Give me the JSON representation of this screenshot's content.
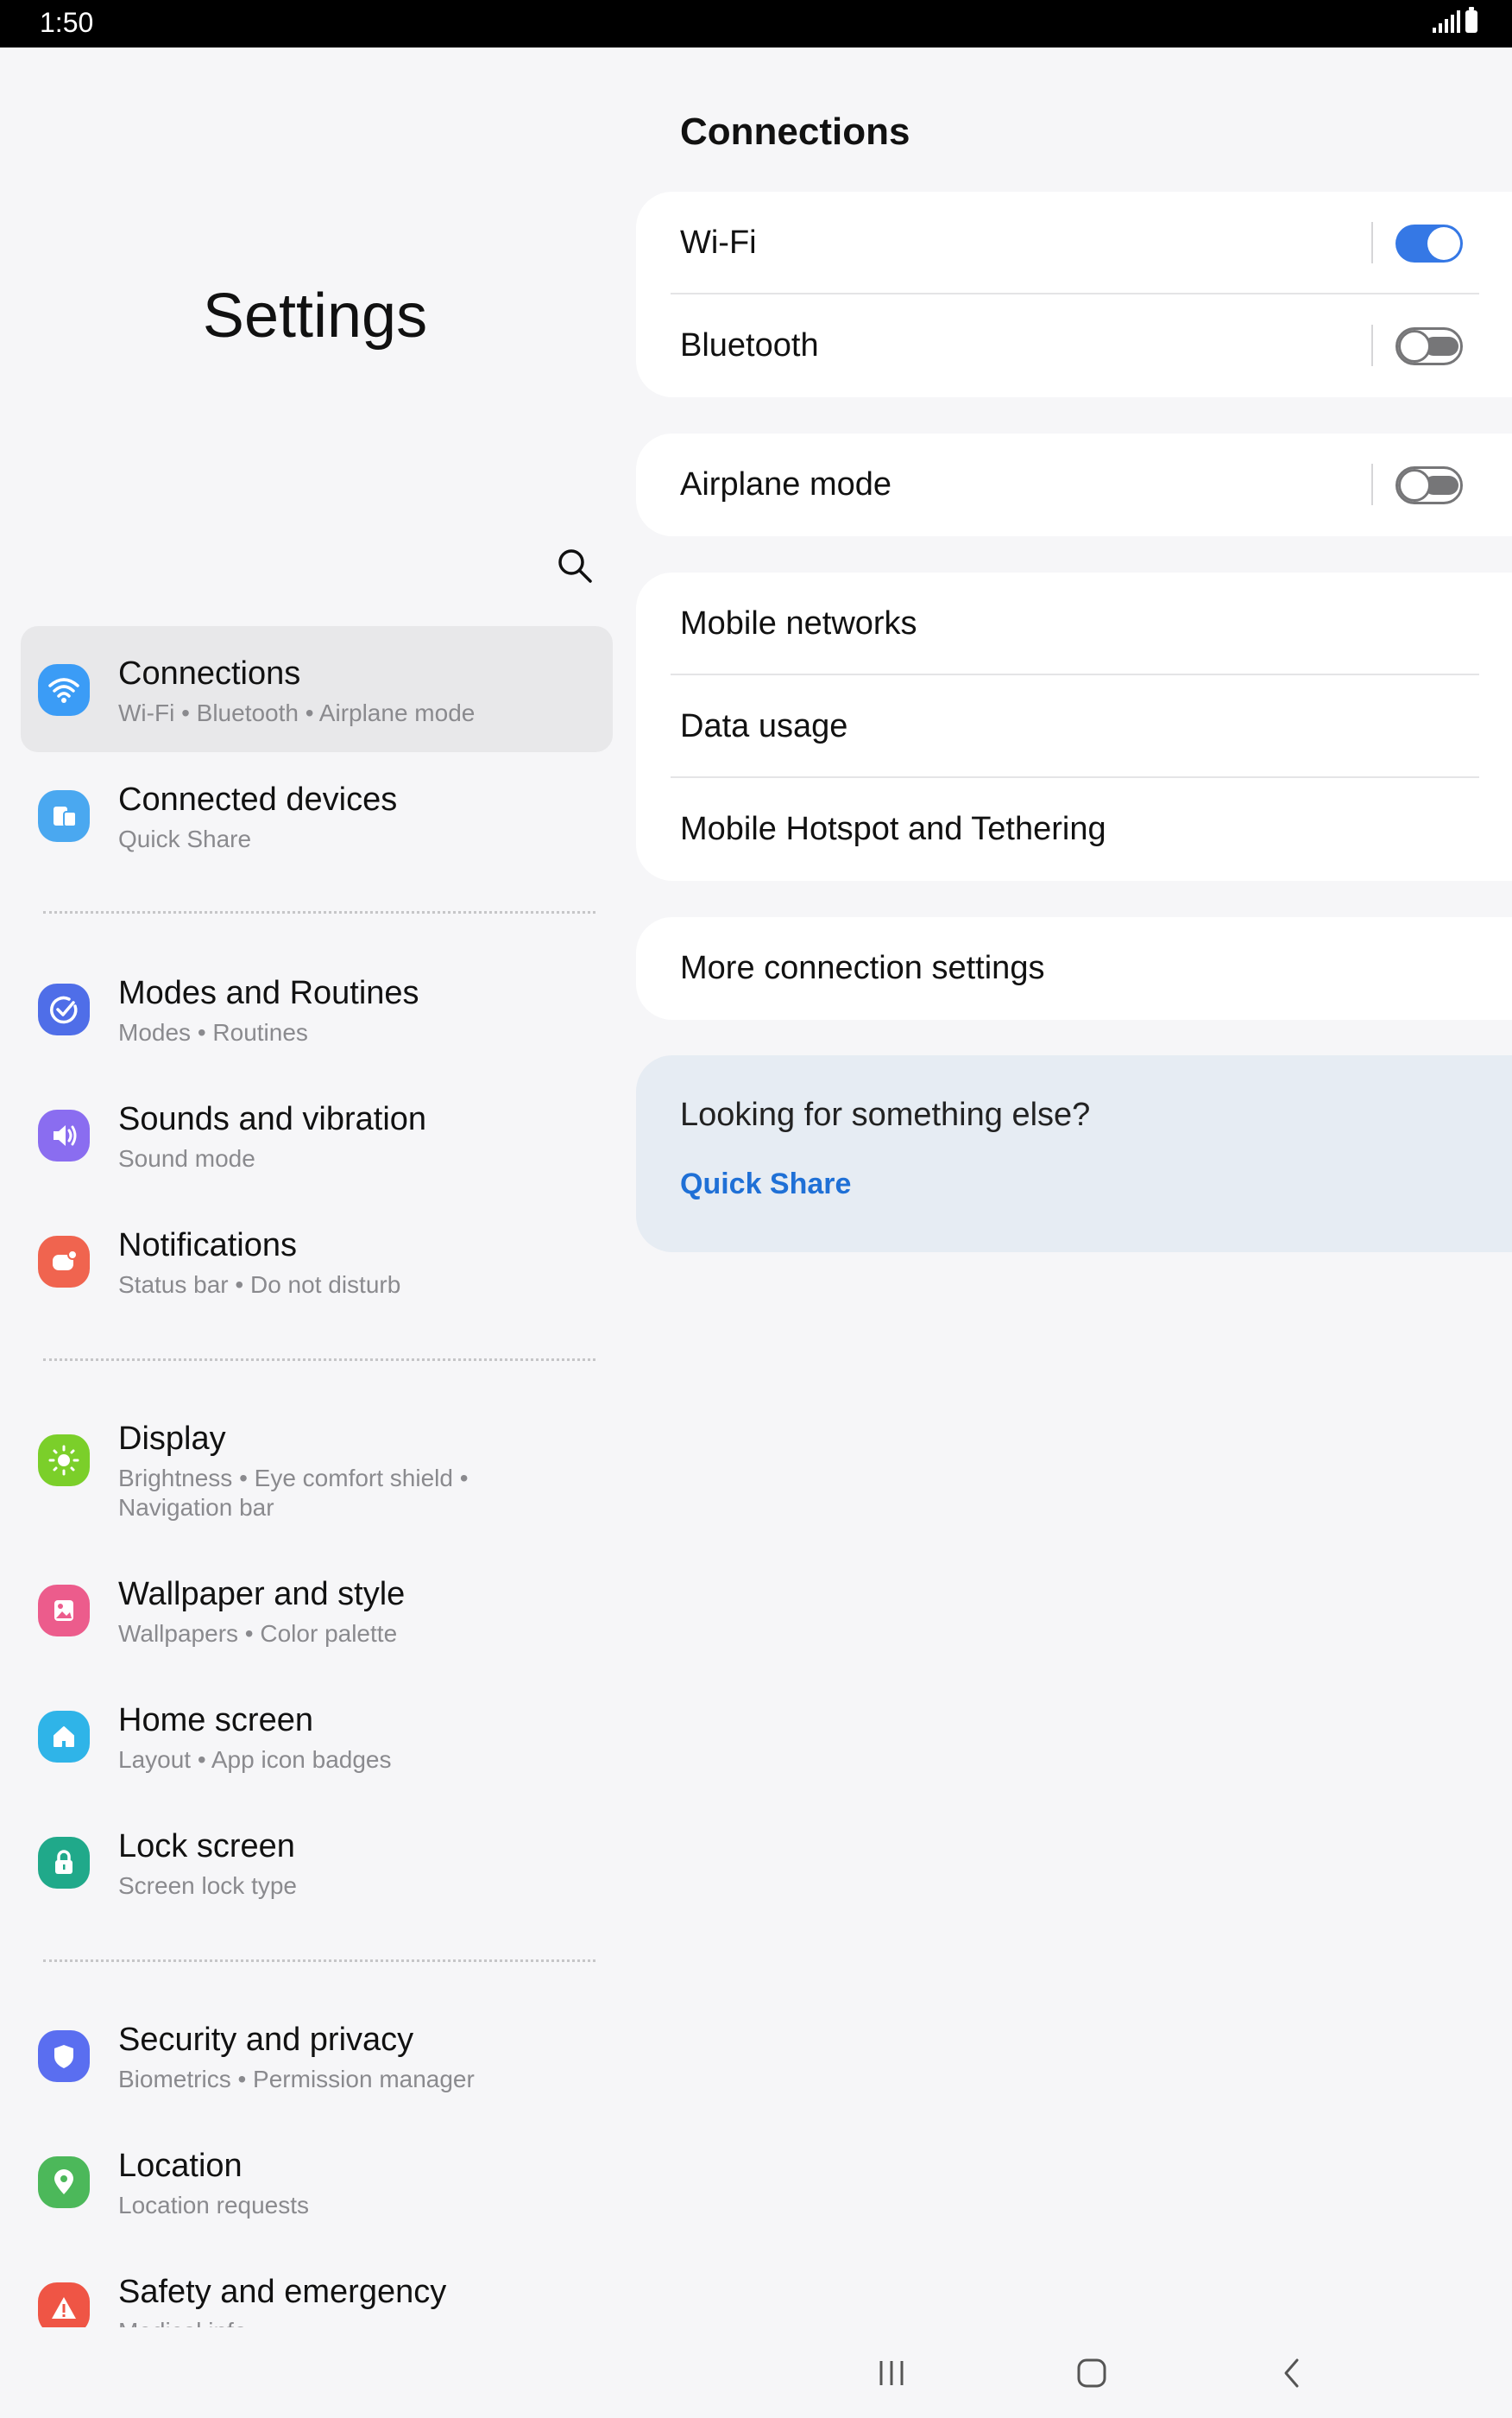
{
  "status_bar": {
    "time": "1:50"
  },
  "left": {
    "title": "Settings",
    "menu": [
      {
        "title": "Connections",
        "subtitle": "Wi-Fi  •  Bluetooth  •  Airplane mode",
        "icon": "wifi-icon",
        "color": "#3b9cf6",
        "active": true
      },
      {
        "title": "Connected devices",
        "subtitle": "Quick Share",
        "icon": "devices-icon",
        "color": "#4aa8f0"
      },
      {
        "title": "Modes and Routines",
        "subtitle": "Modes  •  Routines",
        "icon": "check-circle-icon",
        "color": "#4f6ee8"
      },
      {
        "title": "Sounds and vibration",
        "subtitle": "Sound mode",
        "icon": "speaker-icon",
        "color": "#8a6df0"
      },
      {
        "title": "Notifications",
        "subtitle": "Status bar  •  Do not disturb",
        "icon": "notification-icon",
        "color": "#f0644f"
      },
      {
        "title": "Display",
        "subtitle": "Brightness  •  Eye comfort shield  •\nNavigation bar",
        "icon": "sun-icon",
        "color": "#7bcf2a"
      },
      {
        "title": "Wallpaper and style",
        "subtitle": "Wallpapers  •  Color palette",
        "icon": "wallpaper-icon",
        "color": "#ec5c8c"
      },
      {
        "title": "Home screen",
        "subtitle": "Layout  •  App icon badges",
        "icon": "home-icon",
        "color": "#2fb4e8"
      },
      {
        "title": "Lock screen",
        "subtitle": "Screen lock type",
        "icon": "lock-icon",
        "color": "#20a98a"
      },
      {
        "title": "Security and privacy",
        "subtitle": "Biometrics  •  Permission manager",
        "icon": "shield-icon",
        "color": "#5a6ef0"
      },
      {
        "title": "Location",
        "subtitle": "Location requests",
        "icon": "location-pin-icon",
        "color": "#4cb85a"
      },
      {
        "title": "Safety and emergency",
        "subtitle": "Medical info",
        "icon": "warning-icon",
        "color": "#ef5545"
      }
    ]
  },
  "right": {
    "title": "Connections",
    "rows": {
      "wifi": {
        "label": "Wi-Fi",
        "on": true
      },
      "bluetooth": {
        "label": "Bluetooth",
        "on": false
      },
      "airplane": {
        "label": "Airplane mode",
        "on": false
      },
      "mobile_networks": "Mobile networks",
      "data_usage": "Data usage",
      "hotspot": "Mobile Hotspot and Tethering",
      "more": "More connection settings"
    },
    "tip": {
      "title": "Looking for something else?",
      "link": "Quick Share"
    }
  }
}
